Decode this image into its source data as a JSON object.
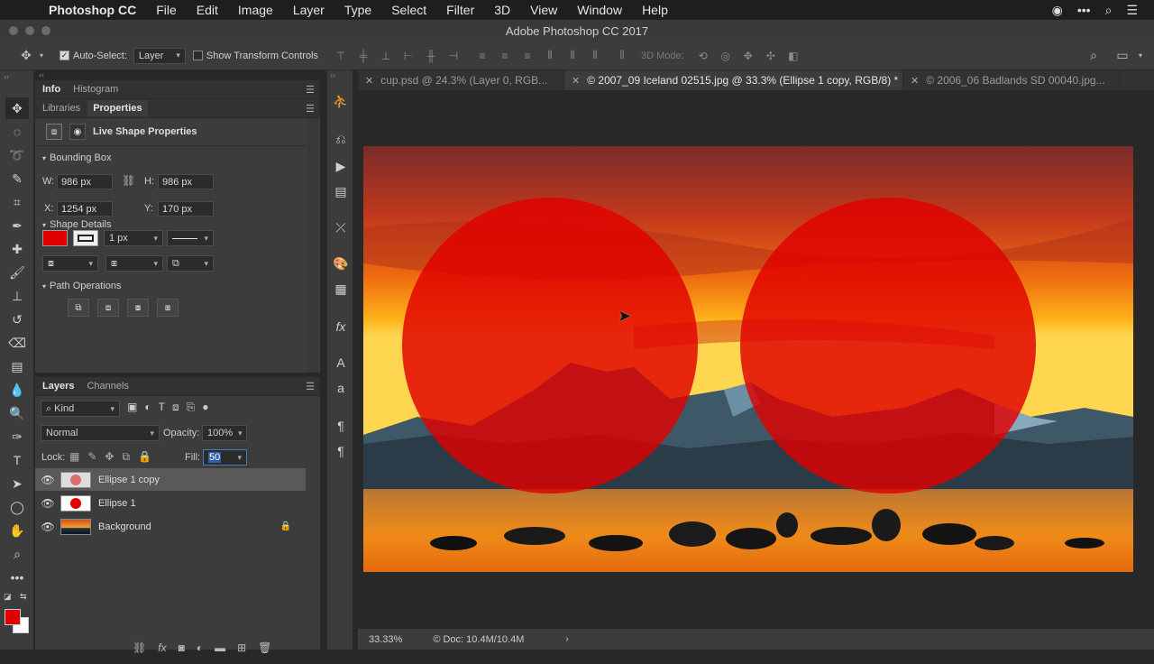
{
  "menubar": {
    "apple": "",
    "app_name": "Photoshop CC",
    "items": [
      "File",
      "Edit",
      "Image",
      "Layer",
      "Type",
      "Select",
      "Filter",
      "3D",
      "View",
      "Window",
      "Help"
    ],
    "right_icons": [
      "creative-cloud-icon",
      "more-icon",
      "search-icon",
      "list-icon"
    ]
  },
  "window": {
    "title": "Adobe Photoshop CC 2017"
  },
  "options": {
    "auto_select_label": "Auto-Select:",
    "auto_select_checked": true,
    "auto_select_target": "Layer",
    "show_transform_label": "Show Transform Controls",
    "mode_3d_label": "3D Mode:"
  },
  "info_panel": {
    "tabs": [
      "Info",
      "Histogram"
    ]
  },
  "properties_panel": {
    "tabs": [
      "Libraries",
      "Properties"
    ],
    "active_tab": "Properties",
    "header": "Live Shape Properties",
    "bounding_box": {
      "title": "Bounding Box",
      "w_label": "W:",
      "w_value": "986 px",
      "h_label": "H:",
      "h_value": "986 px",
      "x_label": "X:",
      "x_value": "1254 px",
      "y_label": "Y:",
      "y_value": "170 px"
    },
    "shape_details": {
      "title": "Shape Details",
      "fill_color": "#e00000",
      "stroke_width": "1 px"
    },
    "path_operations": {
      "title": "Path Operations"
    }
  },
  "layers_panel": {
    "tabs": [
      "Layers",
      "Channels"
    ],
    "kind_label": "Kind",
    "blend_mode": "Normal",
    "opacity_label": "Opacity:",
    "opacity_value": "100%",
    "lock_label": "Lock:",
    "fill_label": "Fill:",
    "fill_value": "50",
    "layers": [
      {
        "name": "Ellipse 1 copy",
        "selected": true
      },
      {
        "name": "Ellipse 1",
        "selected": false
      },
      {
        "name": "Background",
        "selected": false,
        "locked": true
      }
    ]
  },
  "documents": {
    "tabs": [
      {
        "label": "cup.psd @ 24.3% (Layer 0, RGB...",
        "active": false
      },
      {
        "label": "© 2007_09 Iceland 02515.jpg @ 33.3% (Ellipse 1 copy, RGB/8) *",
        "active": true
      },
      {
        "label": "© 2006_06 Badlands SD 00040.jpg...",
        "active": false
      }
    ]
  },
  "statusbar": {
    "zoom": "33.33%",
    "doc_info": "Doc: 10.4M/10.4M"
  },
  "colors": {
    "foreground": "#e00000",
    "background": "#ffffff",
    "shape_fill": "#e00000"
  }
}
